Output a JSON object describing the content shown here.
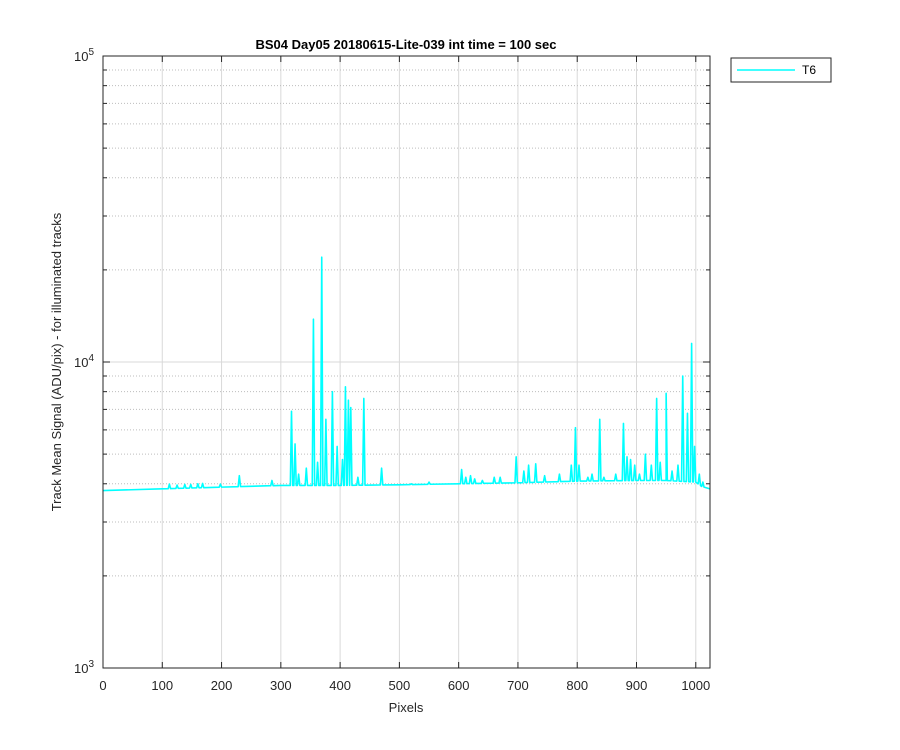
{
  "chart_data": {
    "type": "line",
    "title": "BS04 Day05 20180615-Lite-039 int time = 100 sec",
    "xlabel": "Pixels",
    "ylabel": "Track Mean Signal (ADU/pix) - for illuminated tracks",
    "xlim": [
      0,
      1024
    ],
    "ylim": [
      1000,
      100000
    ],
    "yscale": "log",
    "grid": true,
    "legend_position": "outside-top-right",
    "x_ticks": [
      "0",
      "100",
      "200",
      "300",
      "400",
      "500",
      "600",
      "700",
      "800",
      "900",
      "1000"
    ],
    "y_ticks": [
      {
        "base": "10",
        "exp": "3"
      },
      {
        "base": "10",
        "exp": "4"
      },
      {
        "base": "10",
        "exp": "5"
      }
    ],
    "series": [
      {
        "name": "T6",
        "color": "#00ffff",
        "baseline": [
          [
            0,
            3800
          ],
          [
            100,
            3850
          ],
          [
            200,
            3900
          ],
          [
            300,
            3950
          ],
          [
            400,
            3950
          ],
          [
            500,
            3970
          ],
          [
            600,
            4000
          ],
          [
            700,
            4030
          ],
          [
            800,
            4080
          ],
          [
            900,
            4100
          ],
          [
            950,
            4100
          ],
          [
            1000,
            4050
          ],
          [
            1010,
            3920
          ],
          [
            1024,
            3850
          ]
        ],
        "peaks": [
          [
            112,
            3990
          ],
          [
            125,
            3960
          ],
          [
            138,
            3980
          ],
          [
            148,
            3980
          ],
          [
            160,
            4000
          ],
          [
            168,
            4010
          ],
          [
            198,
            3990
          ],
          [
            230,
            4250
          ],
          [
            285,
            4100
          ],
          [
            318,
            6900
          ],
          [
            324,
            5400
          ],
          [
            330,
            4300
          ],
          [
            343,
            4500
          ],
          [
            355,
            13800
          ],
          [
            362,
            4700
          ],
          [
            369,
            22000
          ],
          [
            376,
            6500
          ],
          [
            387,
            8000
          ],
          [
            395,
            5300
          ],
          [
            404,
            4800
          ],
          [
            409,
            8300
          ],
          [
            414,
            7500
          ],
          [
            418,
            7100
          ],
          [
            430,
            4200
          ],
          [
            440,
            7600
          ],
          [
            470,
            4500
          ],
          [
            520,
            4000
          ],
          [
            550,
            4050
          ],
          [
            605,
            4450
          ],
          [
            612,
            4200
          ],
          [
            620,
            4250
          ],
          [
            627,
            4150
          ],
          [
            640,
            4100
          ],
          [
            660,
            4200
          ],
          [
            670,
            4200
          ],
          [
            697,
            4900
          ],
          [
            710,
            4400
          ],
          [
            718,
            4600
          ],
          [
            730,
            4650
          ],
          [
            745,
            4250
          ],
          [
            770,
            4300
          ],
          [
            790,
            4600
          ],
          [
            797,
            6100
          ],
          [
            803,
            4600
          ],
          [
            818,
            4200
          ],
          [
            825,
            4300
          ],
          [
            838,
            6500
          ],
          [
            845,
            4200
          ],
          [
            865,
            4300
          ],
          [
            878,
            6300
          ],
          [
            884,
            4900
          ],
          [
            890,
            4800
          ],
          [
            897,
            4600
          ],
          [
            905,
            4300
          ],
          [
            915,
            5000
          ],
          [
            925,
            4600
          ],
          [
            934,
            7600
          ],
          [
            940,
            4700
          ],
          [
            950,
            7900
          ],
          [
            960,
            4400
          ],
          [
            970,
            4600
          ],
          [
            978,
            9000
          ],
          [
            986,
            6800
          ],
          [
            993,
            11500
          ],
          [
            998,
            5300
          ],
          [
            1006,
            4300
          ],
          [
            1012,
            4050
          ]
        ]
      }
    ]
  }
}
